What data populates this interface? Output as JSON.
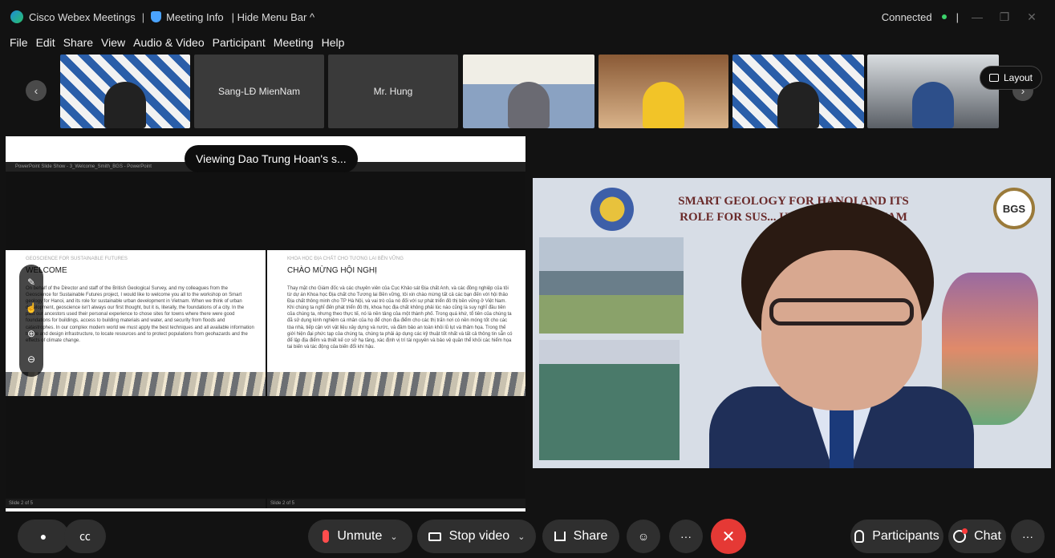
{
  "titlebar": {
    "app_title": "Cisco Webex Meetings",
    "separator": "|",
    "meeting_info": "Meeting Info",
    "hide_menu_bar": "| Hide Menu Bar ^",
    "status": "Connected",
    "right_sep": "|"
  },
  "menu": [
    "File",
    "Edit",
    "Share",
    "View",
    "Audio & Video",
    "Participant",
    "Meeting",
    "Help"
  ],
  "filmstrip": {
    "tiles": [
      {
        "label": ""
      },
      {
        "label": "Sang-LĐ MienNam"
      },
      {
        "label": "Mr. Hung"
      },
      {
        "label": ""
      },
      {
        "label": ""
      },
      {
        "label": ""
      },
      {
        "label": ""
      }
    ],
    "layout_label": "Layout",
    "prev_icon": "chevron-left-icon",
    "next_icon": "chevron-right-icon"
  },
  "share": {
    "viewing_label": "Viewing Dao Trung Hoan's s...",
    "ppt_title": "PowerPoint Slide Show - 3_Welcome_Smith_BGS - PowerPoint",
    "left_slide": {
      "kicker": "GEOSCIENCE FOR SUSTAINABLE FUTURES",
      "title": "WELCOME",
      "body": "On behalf of the Director and staff of the British Geological Survey, and my colleagues from the Geoscience for Sustainable Futures project, I would like to welcome you all to the workshop on Smart geology for Hanoi, and its role for sustainable urban development in Vietnam. When we think of urban development, geoscience isn't always our first thought, but it is, literally, the foundations of a city. In the past our ancestors used their personal experience to chose sites for towns where there were good foundations for buildings, access to building materials and water, and security from floods and catastrophes. In our complex modern world we must apply the best techniques and all available information to site and design infrastructure, to locate resources and to protect populations from geohazards and the effects of climate change.",
      "status": "Slide 2 of 5"
    },
    "right_slide": {
      "kicker": "KHOA HỌC ĐỊA CHẤT CHO TƯƠNG LAI BỀN VỮNG",
      "title": "CHÀO MỪNG HỘI NGHỊ",
      "body": "Thay mặt cho Giám đốc và các chuyên viên của Cục Khảo sát Địa chất Anh, và các đồng nghiệp của tôi từ dự án Khoa học Địa chất cho Tương lai Bền vững, tôi xin chào mừng tất cả các bạn đến với hội thảo Địa chất thông minh cho TP Hà Nội, và vai trò của nó đối với sự phát triển đô thị bền vững ở Việt Nam. Khi chúng ta nghĩ đến phát triển đô thị, khoa học địa chất không phải lúc nào cũng là suy nghĩ đầu tiên của chúng ta, nhưng theo thực tế, nó là nền tảng của một thành phố. Trong quá khứ, tổ tiên của chúng ta đã sử dụng kinh nghiệm cá nhân của họ để chọn địa điểm cho các thị trấn nơi có nền móng tốt cho các tòa nhà, tiếp cận với vật liệu xây dựng và nước, và đảm bảo an toàn khỏi lũ lụt và thảm họa. Trong thế giới hiện đại phức tạp của chúng ta, chúng ta phải áp dụng các kỹ thuật tốt nhất và tất cả thông tin sẵn có để lập địa điểm và thiết kế cơ sở hạ tầng, xác định vị trí tài nguyên và bảo vệ quần thể khỏi các hiểm họa tai biến và tác động của biến đổi khí hậu.",
      "status": "Slide 2 of 5"
    }
  },
  "video": {
    "slide_title": "SMART GEOLOGY FOR HANOI AND ITS ROLE FOR SUS... URBAN DEVEL... NAM",
    "bgs_label": "BGS"
  },
  "bottombar": {
    "unmute": "Unmute",
    "stop_video": "Stop video",
    "share": "Share",
    "participants": "Participants",
    "chat": "Chat",
    "more": "···"
  }
}
